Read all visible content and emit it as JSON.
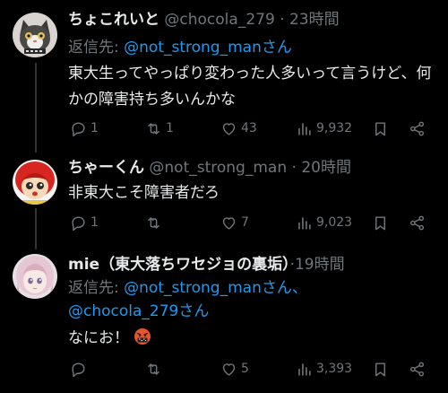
{
  "tweets": [
    {
      "name": "ちょこれいと",
      "handle": "@chocola_279",
      "dot": "·",
      "time": "23時間",
      "reply_prefix": "返信先: ",
      "reply_links": [
        "@not_strong_manさん"
      ],
      "text": "東大生ってやっぱり変わった人多いって言うけど、何かの障害持ち多いんかな",
      "stats": {
        "replies": "1",
        "retweets": "1",
        "likes": "43",
        "views": "9,932"
      }
    },
    {
      "name": "ちゃーくん",
      "handle": "@not_strong_man",
      "dot": "·",
      "time": "20時間",
      "text": "非東大こそ障害者だろ",
      "stats": {
        "replies": "1",
        "retweets": "",
        "likes": "7",
        "views": "9,023"
      }
    },
    {
      "name": "mie（東大落ちワセジョの裏垢）",
      "handle": "",
      "dot": "·",
      "time": "19時間",
      "reply_prefix": "返信先: ",
      "reply_links": [
        "@not_strong_manさん、",
        "@chocola_279さん"
      ],
      "text": "なにお！",
      "stats": {
        "replies": "",
        "retweets": "",
        "likes": "5",
        "views": "3,393"
      }
    }
  ],
  "colors": {
    "background": "#000000",
    "text": "#e7e9ea",
    "secondary": "#71767b",
    "link": "#1d9bf0",
    "thread_line": "#333639"
  },
  "icons": [
    "reply-icon",
    "retweet-icon",
    "like-icon",
    "views-icon",
    "bookmark-icon",
    "share-icon",
    "cursing-face-emoji"
  ]
}
